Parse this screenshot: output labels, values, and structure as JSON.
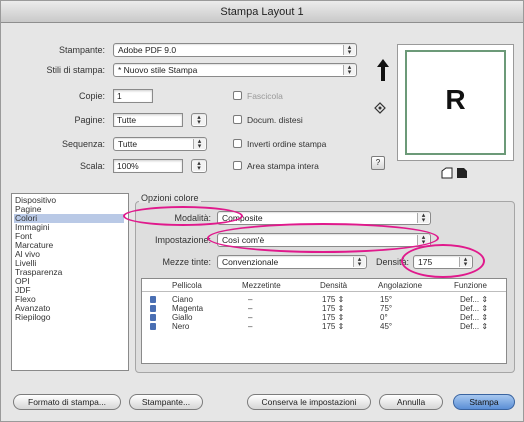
{
  "window": {
    "title": "Stampa Layout 1"
  },
  "form": {
    "printer_label": "Stampante:",
    "printer_value": "Adobe PDF 9.0",
    "styles_label": "Stili di stampa:",
    "styles_value": "* Nuovo stile Stampa",
    "copies_label": "Copie:",
    "copies_value": "1",
    "pages_label": "Pagine:",
    "pages_value": "Tutte",
    "sequence_label": "Sequenza:",
    "sequence_value": "Tutte",
    "scale_label": "Scala:",
    "scale_value": "100%",
    "collate_label": "Fascicola",
    "spreads_label": "Docum. distesi",
    "reverse_label": "Inverti ordine stampa",
    "bleed_label": "Area stampa intera",
    "help_label": "?"
  },
  "preview": {
    "letter": "R"
  },
  "sidebar": {
    "items": [
      "Dispositivo",
      "Pagine",
      "Colori",
      "Immagini",
      "Font",
      "Marcature",
      "Al vivo",
      "Livelli",
      "Trasparenza",
      "OPI",
      "JDF",
      "Flexo",
      "Avanzato",
      "Riepilogo"
    ],
    "selected_index": 2
  },
  "color_options": {
    "group_title": "Opzioni colore",
    "mode_label": "Modalità:",
    "mode_value": "Composite",
    "setup_label": "Impostazione:",
    "setup_value": "Così com'è",
    "halftone_label": "Mezze tinte:",
    "halftone_value": "Convenzionale",
    "density_label": "Densità:",
    "density_value": "175"
  },
  "table": {
    "headers": [
      "Pellicola",
      "Mezzetinte",
      "Densità",
      "Angolazione",
      "Funzione"
    ],
    "rows": [
      {
        "name": "Ciano",
        "halftone": "–",
        "density": "175 ⇕",
        "angle": "15°",
        "func": "Def... ⇕"
      },
      {
        "name": "Magenta",
        "halftone": "–",
        "density": "175 ⇕",
        "angle": "75°",
        "func": "Def... ⇕"
      },
      {
        "name": "Giallo",
        "halftone": "–",
        "density": "175 ⇕",
        "angle": "0°",
        "func": "Def... ⇕"
      },
      {
        "name": "Nero",
        "halftone": "–",
        "density": "175 ⇕",
        "angle": "45°",
        "func": "Def... ⇕"
      }
    ]
  },
  "buttons": {
    "page_setup": "Formato di stampa...",
    "printer": "Stampante...",
    "save_settings": "Conserva le impostazioni",
    "cancel": "Annulla",
    "print": "Stampa"
  },
  "colors": {
    "highlight": "#e0198c",
    "selection": "#b9c9e6",
    "default_button": "#5b8fd6"
  }
}
